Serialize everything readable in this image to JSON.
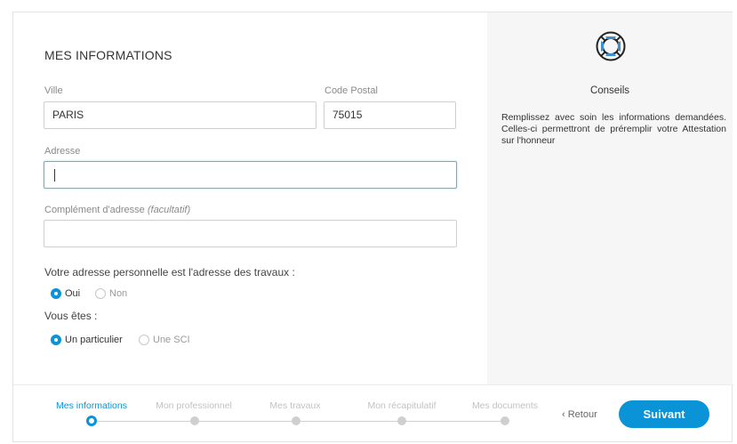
{
  "form": {
    "title": "MES INFORMATIONS",
    "ville": {
      "label": "Ville",
      "value": "PARIS"
    },
    "code_postal": {
      "label": "Code Postal",
      "value": "75015"
    },
    "adresse": {
      "label": "Adresse",
      "value": ""
    },
    "complement": {
      "label": "Complément d'adresse",
      "optional": "(facultatif)",
      "value": ""
    },
    "question_travaux": {
      "label": "Votre adresse personnelle est l'adresse des travaux :",
      "options": [
        "Oui",
        "Non"
      ],
      "selected": "Oui"
    },
    "question_statut": {
      "label": "Vous êtes :",
      "options": [
        "Un particulier",
        "Une SCI"
      ],
      "selected": "Un particulier"
    }
  },
  "help": {
    "icon": "lifebuoy-icon",
    "title": "Conseils",
    "text": "Remplissez avec soin les informations demandées. Celles-ci permettront de préremplir votre Attestation sur l'honneur"
  },
  "stepper": {
    "steps": [
      "Mes informations",
      "Mon professionnel",
      "Mes travaux",
      "Mon récapitulatif",
      "Mes documents"
    ],
    "active_index": 0
  },
  "nav": {
    "back_label": "‹ Retour",
    "next_label": "Suivant"
  },
  "colors": {
    "accent": "#0a93d6",
    "focus_border": "#5cb7dd",
    "panel_bg": "#f6f6f6",
    "inactive_step": "#c2c2c2"
  }
}
